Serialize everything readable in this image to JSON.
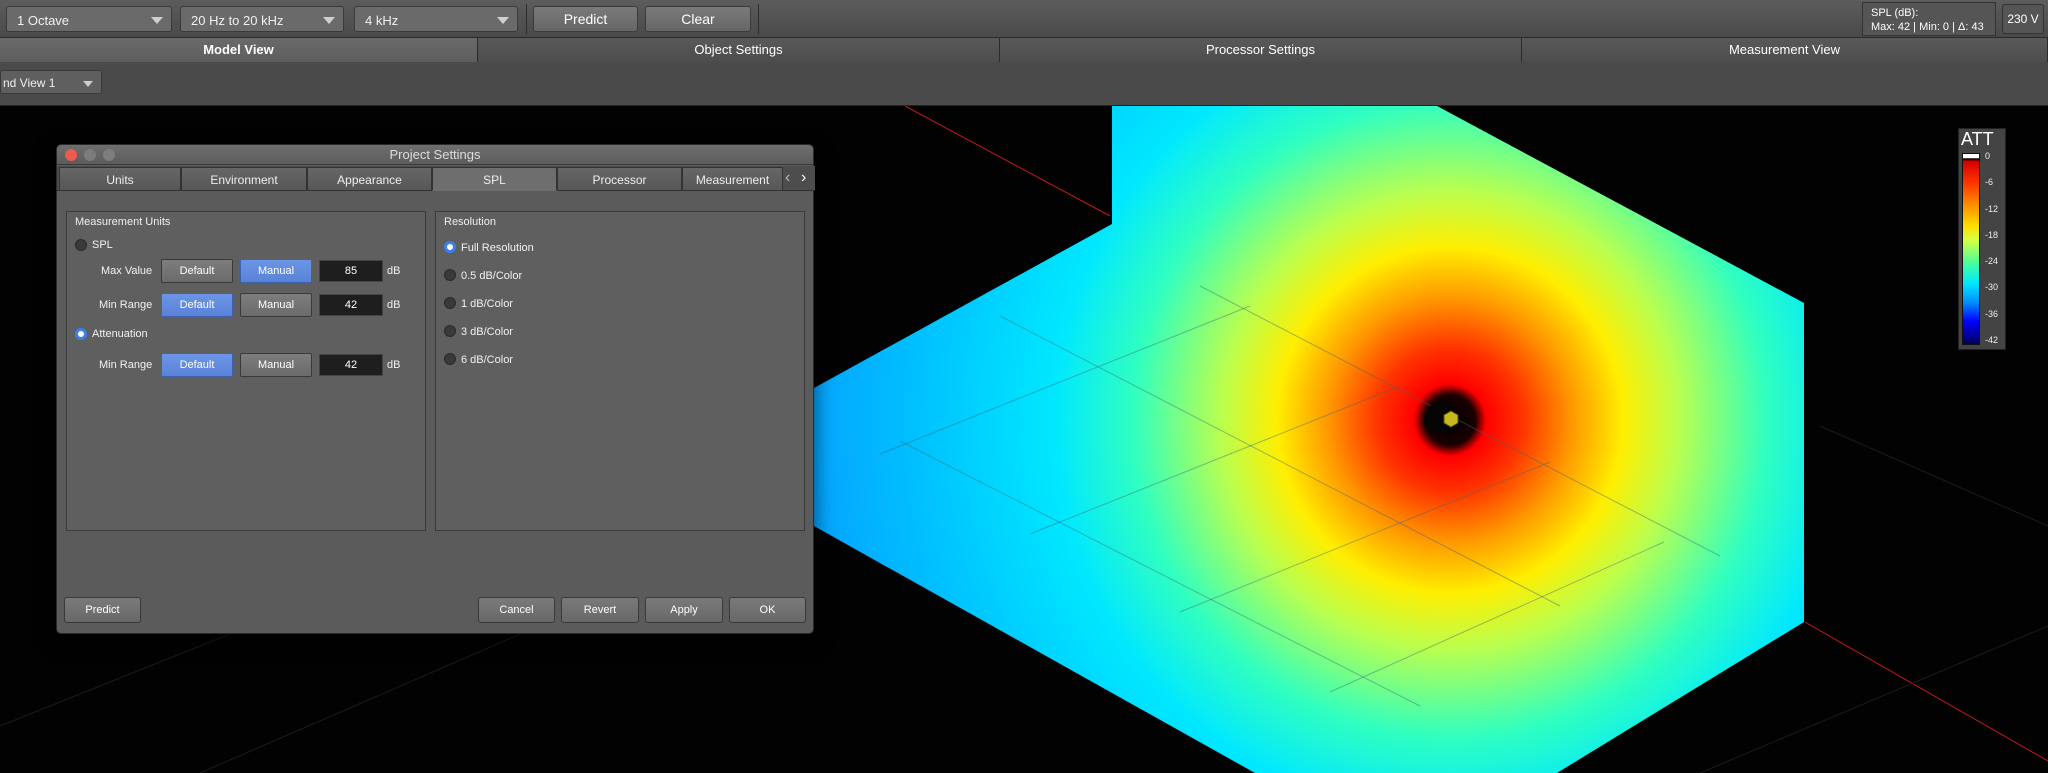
{
  "toolbar": {
    "bandwidth": "1 Octave",
    "range": "20 Hz to 20 kHz",
    "frequency": "4 kHz",
    "predict_label": "Predict",
    "clear_label": "Clear",
    "spl_line1": "SPL (dB):",
    "spl_line2": "Max: 42 | Min: 0 | Δ: 43",
    "voltage": "230 V"
  },
  "main_tabs": [
    {
      "label": "Model View",
      "active": true
    },
    {
      "label": "Object Settings"
    },
    {
      "label": "Processor Settings"
    },
    {
      "label": "Measurement View"
    }
  ],
  "view_select": "nd View 1",
  "legend": {
    "title": "ATT",
    "ticks": [
      "0",
      "-6",
      "-12",
      "-18",
      "-24",
      "-30",
      "-36",
      "-42"
    ]
  },
  "dialog": {
    "title": "Project Settings",
    "tabs": [
      "Units",
      "Environment",
      "Appearance",
      "SPL",
      "Processor",
      "Measurement"
    ],
    "active_tab": "SPL",
    "units_group": {
      "title": "Measurement Units",
      "spl_label": "SPL",
      "max_value_label": "Max Value",
      "min_range_label": "Min Range",
      "attenuation_label": "Attenuation",
      "default_label": "Default",
      "manual_label": "Manual",
      "spl_max_value": "85",
      "spl_min_range": "42",
      "att_min_range": "42",
      "unit": "dB"
    },
    "resolution_group": {
      "title": "Resolution",
      "options": [
        "Full Resolution",
        "0.5 dB/Color",
        "1 dB/Color",
        "3 dB/Color",
        "6 dB/Color"
      ],
      "selected": "Full Resolution"
    },
    "footer": {
      "predict": "Predict",
      "cancel": "Cancel",
      "revert": "Revert",
      "apply": "Apply",
      "ok": "OK"
    }
  },
  "colors": {
    "accent_blue": "#5a83d8",
    "close_red": "#ed5a50",
    "heat_center": "#ff0000",
    "heat_edge": "#0a9cff"
  }
}
